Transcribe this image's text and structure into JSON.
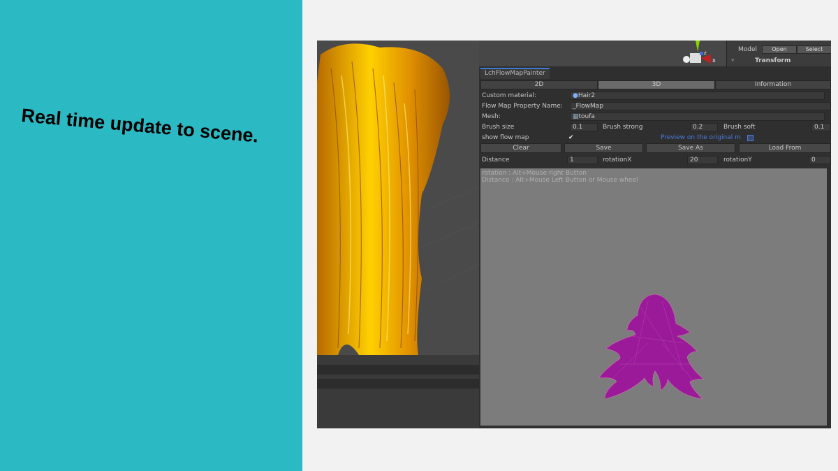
{
  "slide": {
    "caption": "Real time update to scene."
  },
  "inspector": {
    "model_label": "Model",
    "open_label": "Open",
    "select_label": "Select",
    "transform_label": "Transform"
  },
  "gizmo": {
    "z": "z",
    "x": "x"
  },
  "window": {
    "tab_title": "LchFlowMapPainter",
    "modes": [
      "2D",
      "3D",
      "Information"
    ],
    "active_mode": "3D",
    "custom_material_label": "Custom material:",
    "custom_material_value": "Hair2",
    "flow_map_property_label": "Flow Map Property Name:",
    "flow_map_property_value": "_FlowMap",
    "mesh_label": "Mesh:",
    "mesh_value": "toufa",
    "brush_size_label": "Brush size",
    "brush_size_value": "0.1",
    "brush_strong_label": "Brush strong",
    "brush_strong_value": "0.2",
    "brush_soft_label": "Brush soft",
    "brush_soft_value": "0.1",
    "show_flow_map_label": "show flow map",
    "show_flow_map_checked": true,
    "preview_original_label": "Preview on the original m",
    "preview_original_checked": false,
    "buttons": {
      "clear": "Clear",
      "save": "Save",
      "save_as": "Save As",
      "load_from": "Load From"
    },
    "distance_label": "Distance",
    "distance_value": "1",
    "rotationX_label": "rotationX",
    "rotationX_value": "20",
    "rotationY_label": "rotationY",
    "rotationY_value": "0",
    "hint_rotation": "rotation : Alt+Mouse right Button",
    "hint_distance": "Distance : Alt+Mouse Left Button or Mouse wheel"
  },
  "colors": {
    "teal": "#2bbac3",
    "hair": "#e8a400",
    "mesh": "#9a1a9a",
    "link": "#4a7be0"
  }
}
